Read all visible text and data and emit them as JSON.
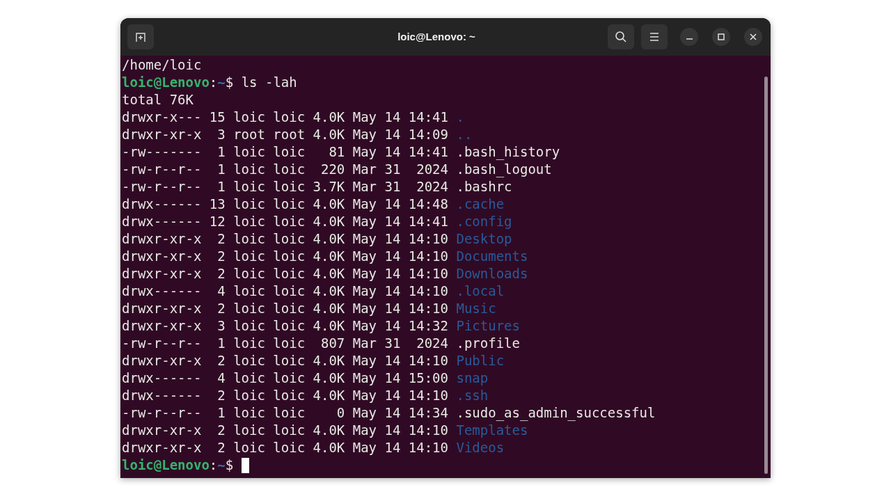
{
  "window": {
    "title": "loic@Lenovo: ~"
  },
  "lines": [
    {
      "kind": "output",
      "text": "/home/loic"
    },
    {
      "kind": "prompt",
      "host": "loic@Lenovo",
      "separator": ":",
      "path": "~",
      "symbol": "$",
      "command": "ls -lah",
      "cursor": false
    },
    {
      "kind": "output",
      "text": "total 76K"
    },
    {
      "kind": "entry",
      "meta": "drwxr-x--- 15 loic loic 4.0K May 14 14:41",
      "name": ".",
      "dir": true
    },
    {
      "kind": "entry",
      "meta": "drwxr-xr-x  3 root root 4.0K May 14 14:09",
      "name": "..",
      "dir": true
    },
    {
      "kind": "entry",
      "meta": "-rw-------  1 loic loic   81 May 14 14:41",
      "name": ".bash_history",
      "dir": false
    },
    {
      "kind": "entry",
      "meta": "-rw-r--r--  1 loic loic  220 Mar 31  2024",
      "name": ".bash_logout",
      "dir": false
    },
    {
      "kind": "entry",
      "meta": "-rw-r--r--  1 loic loic 3.7K Mar 31  2024",
      "name": ".bashrc",
      "dir": false
    },
    {
      "kind": "entry",
      "meta": "drwx------ 13 loic loic 4.0K May 14 14:48",
      "name": ".cache",
      "dir": true
    },
    {
      "kind": "entry",
      "meta": "drwx------ 12 loic loic 4.0K May 14 14:41",
      "name": ".config",
      "dir": true
    },
    {
      "kind": "entry",
      "meta": "drwxr-xr-x  2 loic loic 4.0K May 14 14:10",
      "name": "Desktop",
      "dir": true
    },
    {
      "kind": "entry",
      "meta": "drwxr-xr-x  2 loic loic 4.0K May 14 14:10",
      "name": "Documents",
      "dir": true
    },
    {
      "kind": "entry",
      "meta": "drwxr-xr-x  2 loic loic 4.0K May 14 14:10",
      "name": "Downloads",
      "dir": true
    },
    {
      "kind": "entry",
      "meta": "drwx------  4 loic loic 4.0K May 14 14:10",
      "name": ".local",
      "dir": true
    },
    {
      "kind": "entry",
      "meta": "drwxr-xr-x  2 loic loic 4.0K May 14 14:10",
      "name": "Music",
      "dir": true
    },
    {
      "kind": "entry",
      "meta": "drwxr-xr-x  3 loic loic 4.0K May 14 14:32",
      "name": "Pictures",
      "dir": true
    },
    {
      "kind": "entry",
      "meta": "-rw-r--r--  1 loic loic  807 Mar 31  2024",
      "name": ".profile",
      "dir": false
    },
    {
      "kind": "entry",
      "meta": "drwxr-xr-x  2 loic loic 4.0K May 14 14:10",
      "name": "Public",
      "dir": true
    },
    {
      "kind": "entry",
      "meta": "drwx------  4 loic loic 4.0K May 14 15:00",
      "name": "snap",
      "dir": true
    },
    {
      "kind": "entry",
      "meta": "drwx------  2 loic loic 4.0K May 14 14:10",
      "name": ".ssh",
      "dir": true
    },
    {
      "kind": "entry",
      "meta": "-rw-r--r--  1 loic loic    0 May 14 14:34",
      "name": ".sudo_as_admin_successful",
      "dir": false
    },
    {
      "kind": "entry",
      "meta": "drwxr-xr-x  2 loic loic 4.0K May 14 14:10",
      "name": "Templates",
      "dir": true
    },
    {
      "kind": "entry",
      "meta": "drwxr-xr-x  2 loic loic 4.0K May 14 14:10",
      "name": "Videos",
      "dir": true
    },
    {
      "kind": "prompt",
      "host": "loic@Lenovo",
      "separator": ":",
      "path": "~",
      "symbol": "$",
      "cursor": true
    }
  ]
}
